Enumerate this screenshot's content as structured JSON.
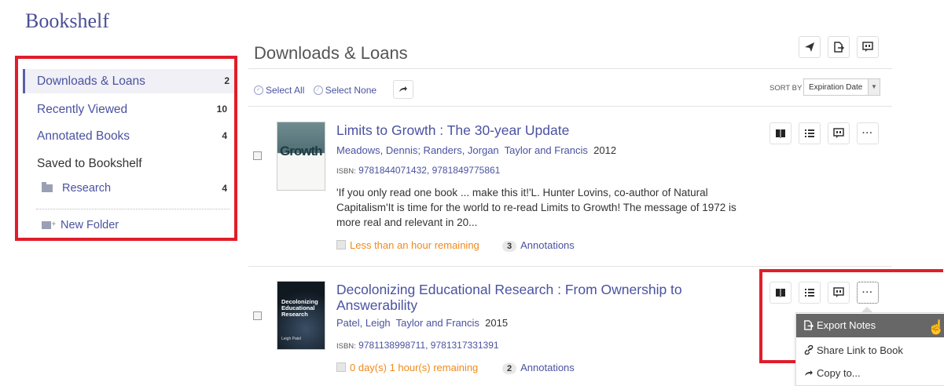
{
  "page_title": "Bookshelf",
  "sidebar": {
    "items": [
      {
        "label": "Downloads & Loans",
        "count": "2"
      },
      {
        "label": "Recently Viewed",
        "count": "10"
      },
      {
        "label": "Annotated Books",
        "count": "4"
      }
    ],
    "saved_label": "Saved to Bookshelf",
    "folders": [
      {
        "label": "Research",
        "count": "4"
      }
    ],
    "new_folder_label": "New Folder"
  },
  "main": {
    "title": "Downloads & Loans",
    "select_all": "Select All",
    "select_none": "Select None",
    "sort_label": "SORT BY",
    "sort_value": "Expiration Date"
  },
  "books": [
    {
      "cover_text": "Growth",
      "title": "Limits to Growth : The 30-year Update",
      "authors": "Meadows, Dennis; Randers, Jorgan",
      "publisher": "Taylor and Francis",
      "year": "2012",
      "isbn_label": "ISBN:",
      "isbn": "9781844071432, 9781849775861",
      "description": "'If you only read one book ... make this it!'L. Hunter Lovins, co-author of Natural Capitalism'It is time for the world to re-read Limits to Growth! The message of 1972 is more real and relevant in 20...",
      "remaining": "Less than an hour remaining",
      "annotations_count": "3",
      "annotations_label": "Annotations"
    },
    {
      "cover_text": "Decolonizing Educational Research",
      "cover_author": "Leigh Patel",
      "title_line1": "Decolonizing Educational Research : From Ownership to",
      "title_line2": "Answerability",
      "authors": "Patel, Leigh",
      "publisher": "Taylor and Francis",
      "year": "2015",
      "isbn_label": "ISBN:",
      "isbn": "9781138998711, 9781317331391",
      "remaining": "0 day(s) 1 hour(s) remaining",
      "annotations_count": "2",
      "annotations_label": "Annotations"
    }
  ],
  "dropdown_menu": {
    "items": [
      "Export Notes",
      "Share Link to Book",
      "Copy to..."
    ]
  },
  "icons": {
    "share": "paper-plane-icon",
    "export": "export-icon",
    "notes": "quote-icon",
    "read": "book-icon",
    "toc": "list-icon",
    "more": "ellipsis-icon"
  },
  "colors": {
    "accent": "#4a52a0",
    "highlight_box": "#e01d2a",
    "remaining": "#f08a1c",
    "menu_highlight": "#676767"
  }
}
